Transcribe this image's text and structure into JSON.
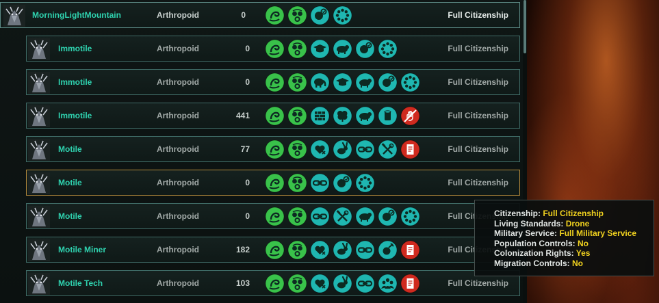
{
  "rows": [
    {
      "name": "MorningLightMountain",
      "species": "Arthropoid",
      "population": "0",
      "citizenship": "Full Citizenship",
      "traits": [
        "amoeba-icon",
        "gasmask-icon",
        "rabbit-reject-icon",
        "dotted-ring-icon"
      ]
    },
    {
      "name": "Immotile",
      "species": "Arthropoid",
      "population": "0",
      "citizenship": "Full Citizenship",
      "traits": [
        "amoeba-icon",
        "gasmask-icon",
        "graduation-cap-icon",
        "bear-icon",
        "rabbit-reject-icon",
        "dotted-ring-icon"
      ]
    },
    {
      "name": "Immotile",
      "species": "Arthropoid",
      "population": "0",
      "citizenship": "Full Citizenship",
      "traits": [
        "amoeba-icon",
        "gasmask-icon",
        "elephant-icon",
        "graduation-cap-icon",
        "bear-icon",
        "rabbit-reject-icon",
        "dotted-ring-icon"
      ]
    },
    {
      "name": "Immotile",
      "species": "Arthropoid",
      "population": "441",
      "citizenship": "Full Citizenship",
      "traits": [
        "amoeba-icon",
        "gasmask-icon",
        "brick-wall-icon",
        "brain-icon",
        "bear-icon",
        "cylinder-icon",
        "no-hand-icon"
      ]
    },
    {
      "name": "Motile",
      "species": "Arthropoid",
      "population": "77",
      "citizenship": "Full Citizenship",
      "traits": [
        "amoeba-icon",
        "gasmask-icon",
        "broken-heart-icon",
        "rabbit-icon",
        "chain-icon",
        "crossed-tools-icon",
        "red-document-icon"
      ]
    },
    {
      "name": "Motile",
      "species": "Arthropoid",
      "population": "0",
      "citizenship": "Full Citizenship",
      "traits": [
        "amoeba-icon",
        "gasmask-icon",
        "chain-icon",
        "rabbit-reject-icon",
        "dotted-ring-icon"
      ]
    },
    {
      "name": "Motile",
      "species": "Arthropoid",
      "population": "0",
      "citizenship": "Full Citizenship",
      "traits": [
        "amoeba-icon",
        "gasmask-icon",
        "chain-icon",
        "crossed-tools-icon",
        "bear-icon",
        "rabbit-reject-icon",
        "dotted-ring-icon"
      ]
    },
    {
      "name": "Motile Miner",
      "species": "Arthropoid",
      "population": "182",
      "citizenship": "Full Citizenship",
      "traits": [
        "amoeba-icon",
        "gasmask-icon",
        "broken-heart-icon",
        "rabbit-icon",
        "chain-icon",
        "planet-pick-icon",
        "red-document-icon"
      ]
    },
    {
      "name": "Motile Tech",
      "species": "Arthropoid",
      "population": "103",
      "citizenship": "Full Citizenship",
      "traits": [
        "amoeba-icon",
        "gasmask-icon",
        "broken-heart-icon",
        "rabbit-icon",
        "chain-icon",
        "crowd-icon",
        "red-document-icon"
      ]
    }
  ],
  "tooltip": [
    {
      "key": "Citizenship:",
      "value": "Full Citizenship"
    },
    {
      "key": "Living Standards:",
      "value": "Drone"
    },
    {
      "key": "Military Service:",
      "value": "Full Military Service"
    },
    {
      "key": "Population Controls:",
      "value": "No"
    },
    {
      "key": "Colonization Rights:",
      "value": "Yes"
    },
    {
      "key": "Migration Controls:",
      "value": "No"
    }
  ],
  "colors": {
    "trait_green": "#39c24a",
    "trait_teal": "#1fb7b1",
    "trait_red": "#d02a1f",
    "name_teal": "#2fd3b0",
    "tooltip_value": "#f1d21f",
    "selected_border": "#b58a3c"
  }
}
